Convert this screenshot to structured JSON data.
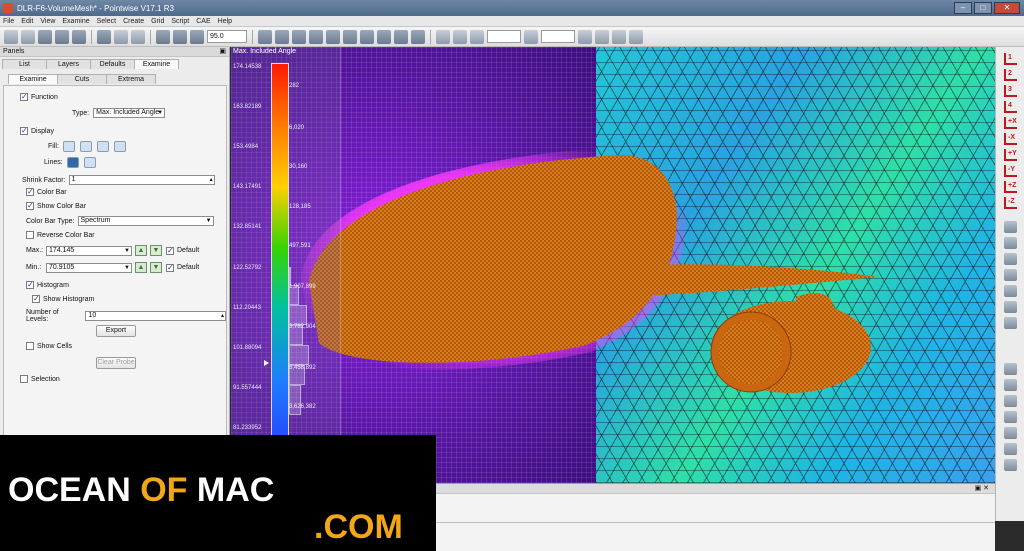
{
  "window": {
    "title": "DLR-F6-VolumeMesh* - Pointwise V17.1 R3"
  },
  "menu": [
    "File",
    "Edit",
    "View",
    "Examine",
    "Select",
    "Create",
    "Grid",
    "Script",
    "CAE",
    "Help"
  ],
  "toolbar": {
    "zoom_value": "95.0"
  },
  "panels": {
    "header": "Panels",
    "top_tabs": [
      "List",
      "Layers",
      "Defaults",
      "Examine"
    ],
    "sub_tabs": [
      "Examine",
      "Cuts",
      "Extrema"
    ],
    "function_label": "Function",
    "type_label": "Type:",
    "type_value": "Max. Included Angle",
    "display_label": "Display",
    "fill_label": "Fill:",
    "lines_label": "Lines:",
    "shrink_label": "Shrink Factor:",
    "shrink_value": "1",
    "color_bar_label": "Color Bar",
    "show_color_bar_label": "Show Color Bar",
    "color_bar_type_label": "Color Bar Type:",
    "color_bar_type_value": "Spectrum",
    "reverse_color_bar_label": "Reverse Color Bar",
    "max_label": "Max.:",
    "max_value": "174.145",
    "min_label": "Min.:",
    "min_value": "70.9105",
    "default_label": "Default",
    "histogram_label": "Histogram",
    "show_histogram_label": "Show Histogram",
    "levels_label": "Number of Levels:",
    "levels_value": "10",
    "export_label": "Export",
    "show_cells_label": "Show Cells",
    "clear_probe_label": "Clear Probe",
    "selection_label": "Selection"
  },
  "colorbar": {
    "title": "Max. Included Angle",
    "tick_labels": [
      "174.14538",
      "163.82189",
      "153.4984",
      "143.17491",
      "132.85141",
      "122.52792",
      "112.20443",
      "101.88094",
      "91.557444",
      "81.233952"
    ],
    "histogram_counts": [
      "282",
      "6,020",
      "30,160",
      "128,185",
      "497,591",
      "1,907,899",
      "3,782,904",
      "5,458,892",
      "3,626,382"
    ]
  },
  "right_toolbar": {
    "axes": [
      "1",
      "2",
      "3",
      "4",
      "+X",
      "-X",
      "+Y",
      "-Y",
      "+Z",
      "-Z"
    ]
  },
  "watermark": {
    "part1": "OCEAN ",
    "part2": "OF",
    "part3": " MAC",
    "part4": ".COM"
  }
}
